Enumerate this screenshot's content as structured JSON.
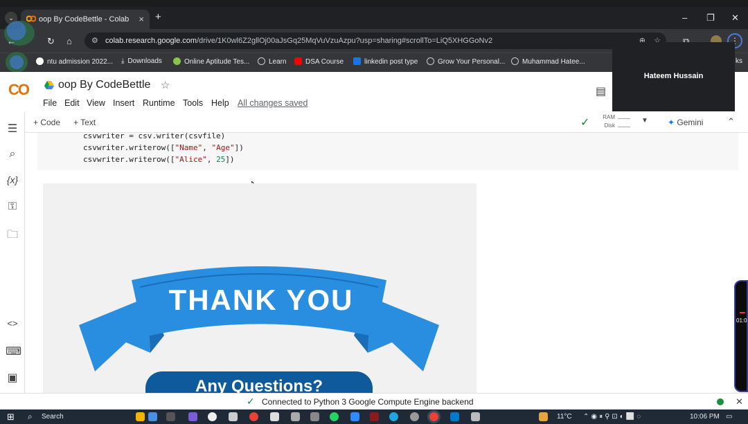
{
  "browser": {
    "tab_title": "oop By CodeBettle - Colab",
    "tab_close": "×",
    "new_tab": "+",
    "url_host": "colab.research.google.com",
    "url_path": "/drive/1K0wl6Z2gllOj00aJsGq25MqVuVzuAzpu?usp=sharing#scrollTo=LiQ5XHGGoNv2",
    "bookmarks": [
      "ntu admission 2022...",
      "Downloads",
      "Online Aptitude Tes...",
      "Learn",
      "DSA Course",
      "linkedin post type",
      "Grow Your Personal...",
      "Muhammad Hatee..."
    ]
  },
  "colab": {
    "logo": "CO",
    "notebook_title": "oop By CodeBettle",
    "menu": [
      "File",
      "Edit",
      "View",
      "Insert",
      "Runtime",
      "Tools",
      "Help"
    ],
    "saved_status": "All changes saved",
    "add_code": "+ Code",
    "add_text": "+ Text",
    "ram_label": "RAM",
    "disk_label": "Disk",
    "gemini": "Gemini"
  },
  "code": {
    "line1": "csvwriter = csv.writer(csvfile)",
    "line2_pre": "csvwriter.writerow([",
    "line2_s1": "\"Name\"",
    "line2_mid": ", ",
    "line2_s2": "\"Age\"",
    "line2_post": "])",
    "line3_pre": "csvwriter.writerow([",
    "line3_s1": "\"Alice\"",
    "line3_mid": ", ",
    "line3_n": "25",
    "line3_post": "])"
  },
  "output_image": {
    "banner_text": "THANK YOU",
    "sub_text": "Any Questions?"
  },
  "video_call": {
    "name": "Hateem Hussain"
  },
  "status": {
    "message": "Connected to Python 3 Google Compute Engine backend"
  },
  "taskbar": {
    "search": "Search",
    "weather": "11°C",
    "time": "10:06 PM"
  },
  "side_widget": {
    "time": "01:0"
  },
  "colors": {
    "banner_blue": "#2a8ee0",
    "button_blue": "#0e5a9a",
    "colab_orange": "#f9ab00"
  }
}
